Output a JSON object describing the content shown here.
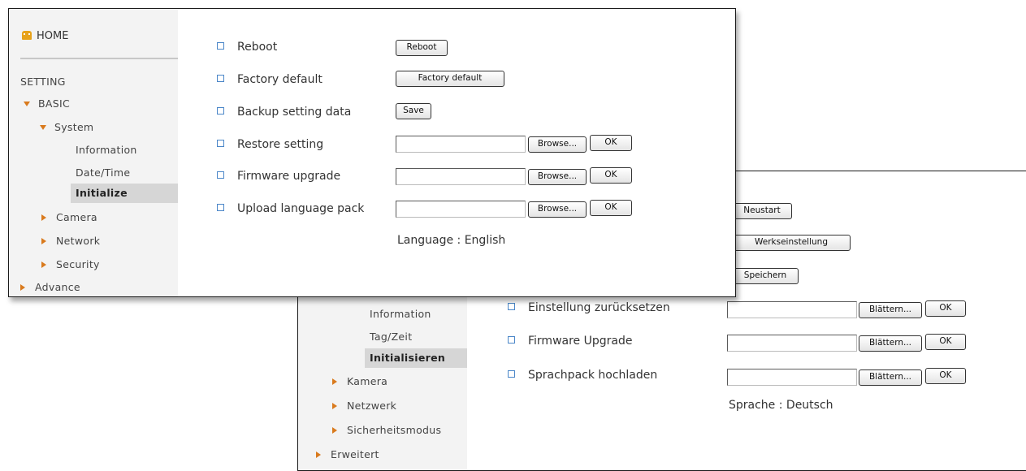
{
  "english": {
    "sidebar": {
      "home": "HOME",
      "setting": "SETTING",
      "basic": "BASIC",
      "system": "System",
      "information": "Information",
      "date_time": "Date/Time",
      "initialize": "Initialize",
      "camera": "Camera",
      "network": "Network",
      "security": "Security",
      "advance": "Advance"
    },
    "rows": {
      "reboot": {
        "label": "Reboot",
        "button": "Reboot"
      },
      "factory": {
        "label": "Factory default",
        "button": "Factory default"
      },
      "backup": {
        "label": "Backup setting data",
        "button": "Save"
      },
      "restore": {
        "label": "Restore setting",
        "browse": "Browse...",
        "ok": "OK"
      },
      "firmware": {
        "label": "Firmware upgrade",
        "browse": "Browse...",
        "ok": "OK"
      },
      "language_pack": {
        "label": "Upload language pack",
        "browse": "Browse...",
        "ok": "OK"
      }
    },
    "language": "Language : English"
  },
  "german": {
    "sidebar": {
      "information": "Information",
      "date_time": "Tag/Zeit",
      "initialize": "Initialisieren",
      "camera": "Kamera",
      "network": "Netzwerk",
      "security": "Sicherheitsmodus",
      "advance": "Erweitert"
    },
    "buttons": {
      "reboot": "Neustart",
      "factory": "Werkseinstellung",
      "save": "Speichern"
    },
    "rows": {
      "restore": {
        "label": "Einstellung zurücksetzen",
        "browse": "Blättern...",
        "ok": "OK"
      },
      "firmware": {
        "label": "Firmware Upgrade",
        "browse": "Blättern...",
        "ok": "OK"
      },
      "language_pack": {
        "label": "Sprachpack hochladen",
        "browse": "Blättern...",
        "ok": "OK"
      }
    },
    "language": "Sprache : Deutsch"
  }
}
